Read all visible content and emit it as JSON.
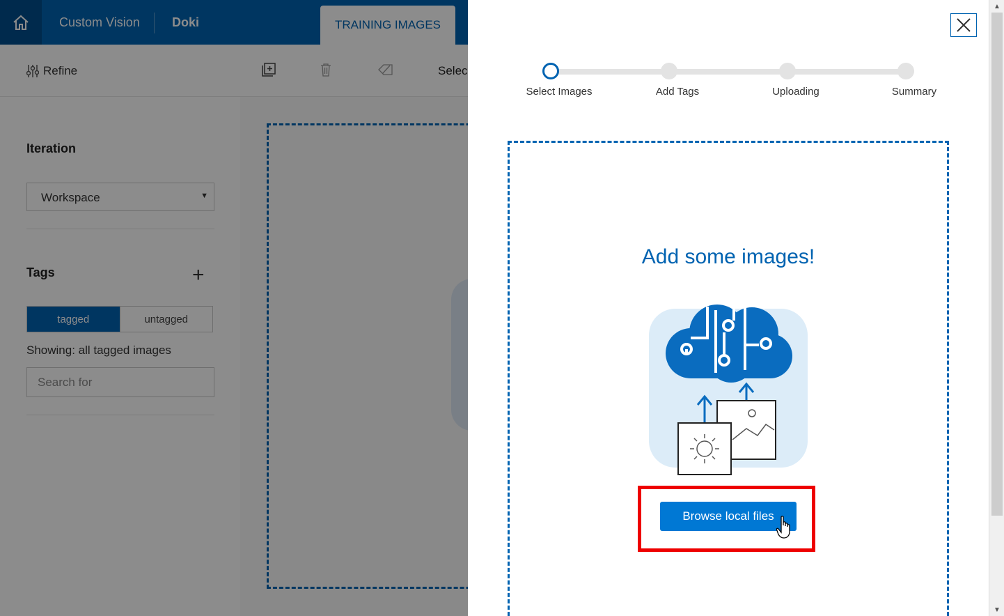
{
  "app": {
    "brand": "Custom Vision",
    "project": "Doki",
    "active_tab": "TRAINING IMAGES"
  },
  "toolbar": {
    "refine_label": "Refine",
    "select_label": "Selec"
  },
  "sidebar": {
    "iteration_title": "Iteration",
    "iteration_value": "Workspace",
    "tags_title": "Tags",
    "tag_filter": {
      "tagged_label": "tagged",
      "untagged_label": "untagged",
      "selected": "tagged"
    },
    "showing_text": "Showing: all tagged images",
    "search_placeholder": "Search for"
  },
  "modal": {
    "steps": [
      {
        "label": "Select Images",
        "state": "active"
      },
      {
        "label": "Add Tags",
        "state": "pending"
      },
      {
        "label": "Uploading",
        "state": "pending"
      },
      {
        "label": "Summary",
        "state": "pending"
      }
    ],
    "dropzone_title": "Add some images!",
    "browse_button_label": "Browse local files"
  },
  "colors": {
    "brand_blue": "#0063b1",
    "button_blue": "#0078d4",
    "highlight_red": "#e00000",
    "illustration_bg": "#dcecf8"
  }
}
